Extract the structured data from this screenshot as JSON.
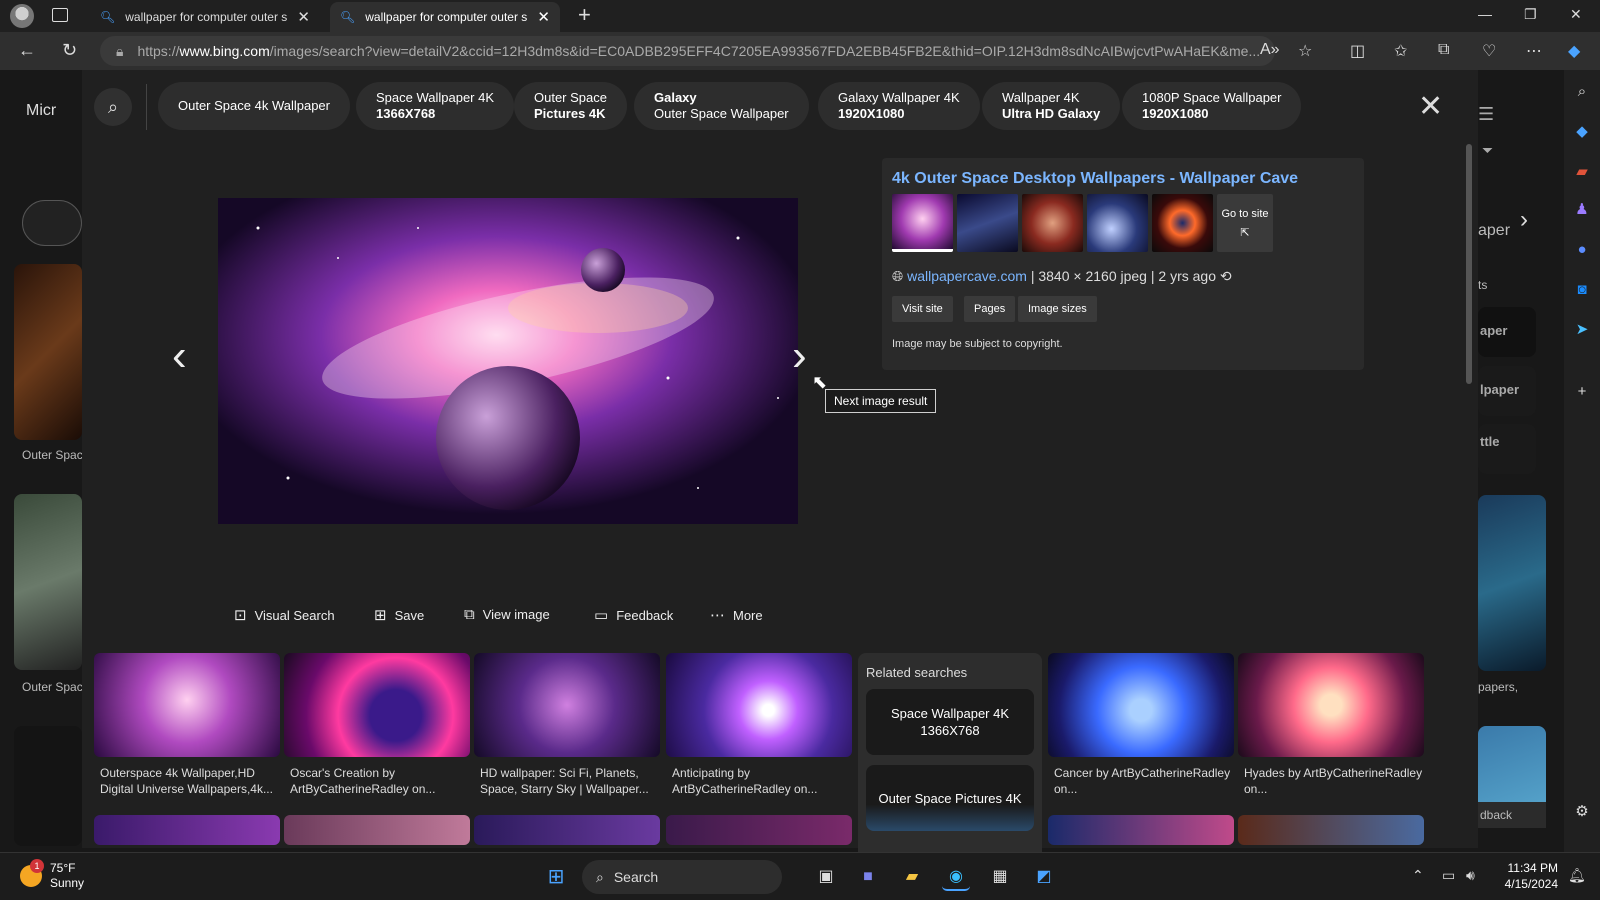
{
  "browser": {
    "tabs": [
      {
        "title": "wallpaper for computer outer sp"
      },
      {
        "title": "wallpaper for computer outer sp"
      }
    ],
    "url_prefix": "https://",
    "url_host": "www.bing.com",
    "url_path": "/images/search?view=detailV2&ccid=12H3dm8s&id=EC0ADBB295EFF4C7205EA993567FDA2EBB45FB2E&thid=OIP.12H3dm8sdNcAIBwjcvtPwAHaEK&me..."
  },
  "background": {
    "logo_text": "Micr",
    "caption_1": "Outer Spac",
    "caption_2": "Outer Spac",
    "right_1": "aper",
    "right_2": "ts",
    "right_3": "aper",
    "right_4": "lpaper",
    "right_5": "ttle",
    "right_6": "papers,",
    "right_7": "dback"
  },
  "chips": [
    {
      "line1": "Outer Space 4k Wallpaper",
      "line2": ""
    },
    {
      "line1": "Space Wallpaper 4K",
      "line2": "1366X768"
    },
    {
      "line1": "Outer Space",
      "line2": "Pictures 4K"
    },
    {
      "line1": "Galaxy",
      "line2": "Outer Space Wallpaper"
    },
    {
      "line1": "Galaxy Wallpaper 4K",
      "line2": "1920X1080"
    },
    {
      "line1": "Wallpaper 4K",
      "line2": "Ultra HD Galaxy"
    },
    {
      "line1": "1080P Space Wallpaper",
      "line2": "1920X1080"
    }
  ],
  "viewer": {
    "tooltip": "Next image result"
  },
  "info": {
    "title": "4k Outer Space Desktop Wallpapers - Wallpaper Cave",
    "go_to_site": "Go to site",
    "domain": "wallpapercave.com",
    "dimensions": "3840 × 2160 jpeg",
    "age": "2 yrs ago",
    "buttons": [
      "Visit site",
      "Pages",
      "Image sizes"
    ],
    "copyright": "Image may be subject to copyright."
  },
  "actions": [
    "Visual Search",
    "Save",
    "View image",
    "Feedback",
    "More"
  ],
  "grid": [
    {
      "caption": "Outerspace 4k Wallpaper,HD Digital Universe Wallpapers,4k..."
    },
    {
      "caption": "Oscar's Creation by ArtByCatherineRadley on..."
    },
    {
      "caption": "HD wallpaper: Sci Fi, Planets, Space, Starry Sky | Wallpaper..."
    },
    {
      "caption": "Anticipating by ArtByCatherineRadley on..."
    },
    {
      "caption": "Cancer by ArtByCatherineRadley on..."
    },
    {
      "caption": "Hyades by ArtByCatherineRadley on..."
    }
  ],
  "related": {
    "heading": "Related searches",
    "items": [
      "Space Wallpaper 4K 1366X768",
      "Outer Space Pictures 4K"
    ]
  },
  "taskbar": {
    "temp": "75°F",
    "condition": "Sunny",
    "badge": "1",
    "search": "Search",
    "time": "11:34 PM",
    "date": "4/15/2024"
  },
  "colors": {
    "accent_link": "#7bb6ff",
    "overlay_bg": "#202020"
  }
}
